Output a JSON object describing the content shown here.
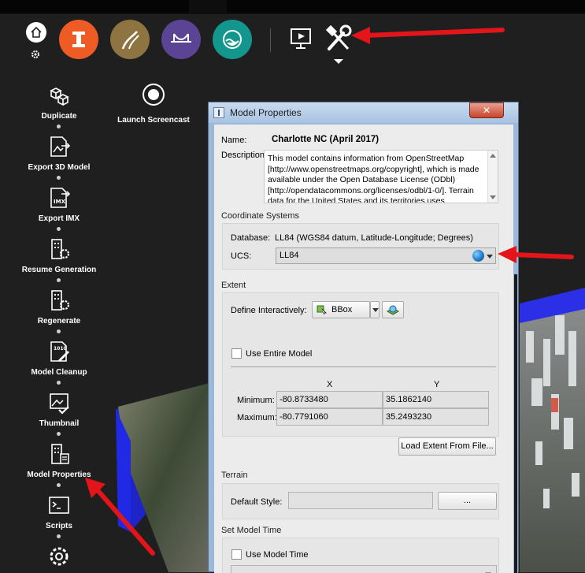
{
  "toolbar": {
    "apps": [
      {
        "name": "infraworks",
        "color": "#ee5b24"
      },
      {
        "name": "roads",
        "color": "#8e7441"
      },
      {
        "name": "bridges",
        "color": "#5b4494"
      },
      {
        "name": "drainage",
        "color": "#12968d"
      }
    ]
  },
  "sidebar": {
    "items": [
      {
        "label": "Duplicate"
      },
      {
        "label": "Export 3D Model"
      },
      {
        "label": "Export IMX"
      },
      {
        "label": "Resume Generation"
      },
      {
        "label": "Regenerate"
      },
      {
        "label": "Model Cleanup"
      },
      {
        "label": "Thumbnail"
      },
      {
        "label": "Model Properties"
      },
      {
        "label": "Scripts"
      }
    ],
    "launch_label": "Launch Screencast"
  },
  "dialog": {
    "title": "Model Properties",
    "close_label": "✕",
    "name_label": "Name:",
    "name_value": "Charlotte NC (April 2017)",
    "description_label": "Description:",
    "description_text": "This model contains information from OpenStreetMap [http://www.openstreetmaps.org/copyright], which is made available under the Open Database License (ODbl) [http://opendatacommons.org/licenses/odbl/1-0/]. Terrain data for the United States and its territories uses",
    "coord_section": "Coordinate Systems",
    "database_label": "Database:",
    "database_value": "LL84 (WGS84 datum, Latitude-Longitude; Degrees)",
    "ucs_label": "UCS:",
    "ucs_value": "LL84",
    "extent_section": "Extent",
    "define_label": "Define Interactively:",
    "define_value": "BBox",
    "use_entire_label": "Use Entire Model",
    "x_header": "X",
    "y_header": "Y",
    "minimum_label": "Minimum:",
    "maximum_label": "Maximum:",
    "min_x": "-80.8733480",
    "min_y": "35.1862140",
    "max_x": "-80.7791060",
    "max_y": "35.2493230",
    "load_extent_label": "Load Extent From File...",
    "terrain_section": "Terrain",
    "default_style_label": "Default Style:",
    "default_style_value": "",
    "browse_label": "...",
    "model_time_section": "Set Model Time",
    "use_model_time_label": "Use Model Time",
    "model_time_value": ""
  },
  "colors": {
    "annotation_arrow": "#e3151a",
    "dialog_frame": "#9bb8d9",
    "close_red": "#c6442d"
  }
}
